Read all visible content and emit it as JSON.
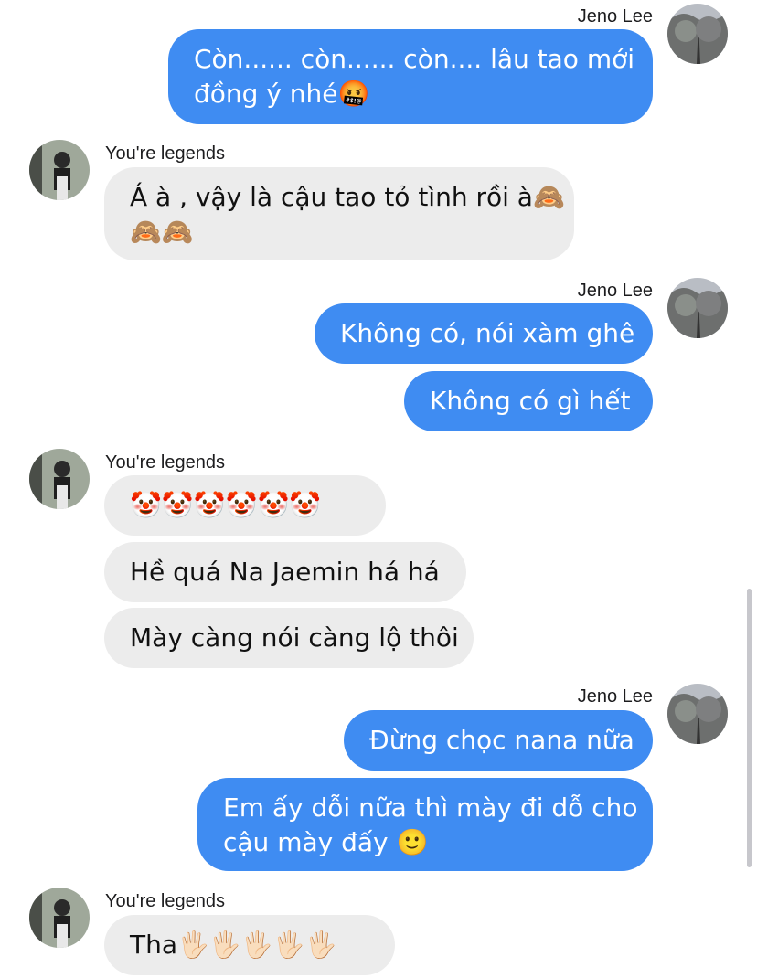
{
  "chat": {
    "participants": {
      "me": "Jeno Lee",
      "other": "You're legends"
    },
    "groups": [
      {
        "sender": "Jeno Lee",
        "side": "right",
        "messages": [
          [
            "Còn...... còn...... còn.... lâu tao mới",
            "đồng ý nhé🤬"
          ]
        ]
      },
      {
        "sender": "You're legends",
        "side": "left",
        "messages": [
          [
            "Á à , vậy là cậu tao tỏ tình rồi à🙈",
            "🙈🙈"
          ]
        ]
      },
      {
        "sender": "Jeno Lee",
        "side": "right",
        "messages": [
          [
            "Không có, nói xàm ghê"
          ],
          [
            "Không có gì hết"
          ]
        ]
      },
      {
        "sender": "You're legends",
        "side": "left",
        "messages": [
          [
            "🤡🤡🤡🤡🤡🤡"
          ],
          [
            "Hề quá Na Jaemin há há"
          ],
          [
            "Mày càng nói càng lộ thôi"
          ]
        ]
      },
      {
        "sender": "Jeno Lee",
        "side": "right",
        "messages": [
          [
            "Đừng chọc nana nữa"
          ],
          [
            "Em ấy dỗi nữa thì mày đi dỗ cho",
            "cậu mày đấy 🙂"
          ]
        ]
      },
      {
        "sender": "You're legends",
        "side": "left",
        "messages": [
          [
            "Tha🖐🏻🖐🏻🖐🏻🖐🏻🖐🏻"
          ]
        ]
      }
    ]
  },
  "colors": {
    "sent_bubble": "#3f8cf2",
    "received_bubble": "#ececec",
    "background": "#ffffff"
  }
}
